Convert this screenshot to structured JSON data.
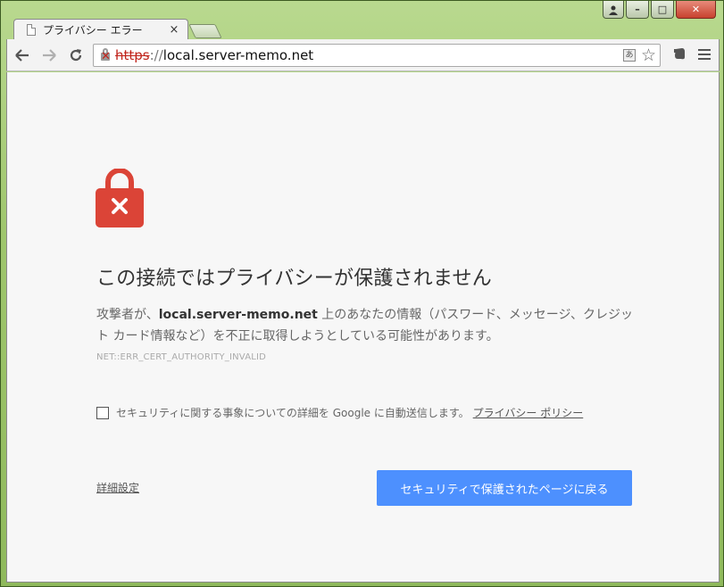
{
  "window": {
    "caption_close": "✕",
    "caption_max": "□",
    "caption_min": "–"
  },
  "tabs": [
    {
      "title": "プライバシー エラー",
      "close": "×"
    }
  ],
  "toolbar": {
    "url_scheme": "https",
    "url_separator": "://",
    "url_host": "local.server-memo.net"
  },
  "page": {
    "heading": "この接続ではプライバシーが保護されません",
    "body_prefix": "攻撃者が、",
    "body_host": "local.server-memo.net",
    "body_suffix": " 上のあなたの情報（パスワード、メッセージ、クレジット カード情報など）を不正に取得しようとしている可能性があります。",
    "error_code": "NET::ERR_CERT_AUTHORITY_INVALID",
    "checkbox_label": "セキュリティに関する事象についての詳細を Google に自動送信します。",
    "policy_link": "プライバシー ポリシー",
    "advanced_link": "詳細設定",
    "back_button": "セキュリティで保護されたページに戻る"
  },
  "colors": {
    "lock_red": "#db4437",
    "button_blue": "#4d90fe",
    "scheme_red": "#c0241b"
  }
}
